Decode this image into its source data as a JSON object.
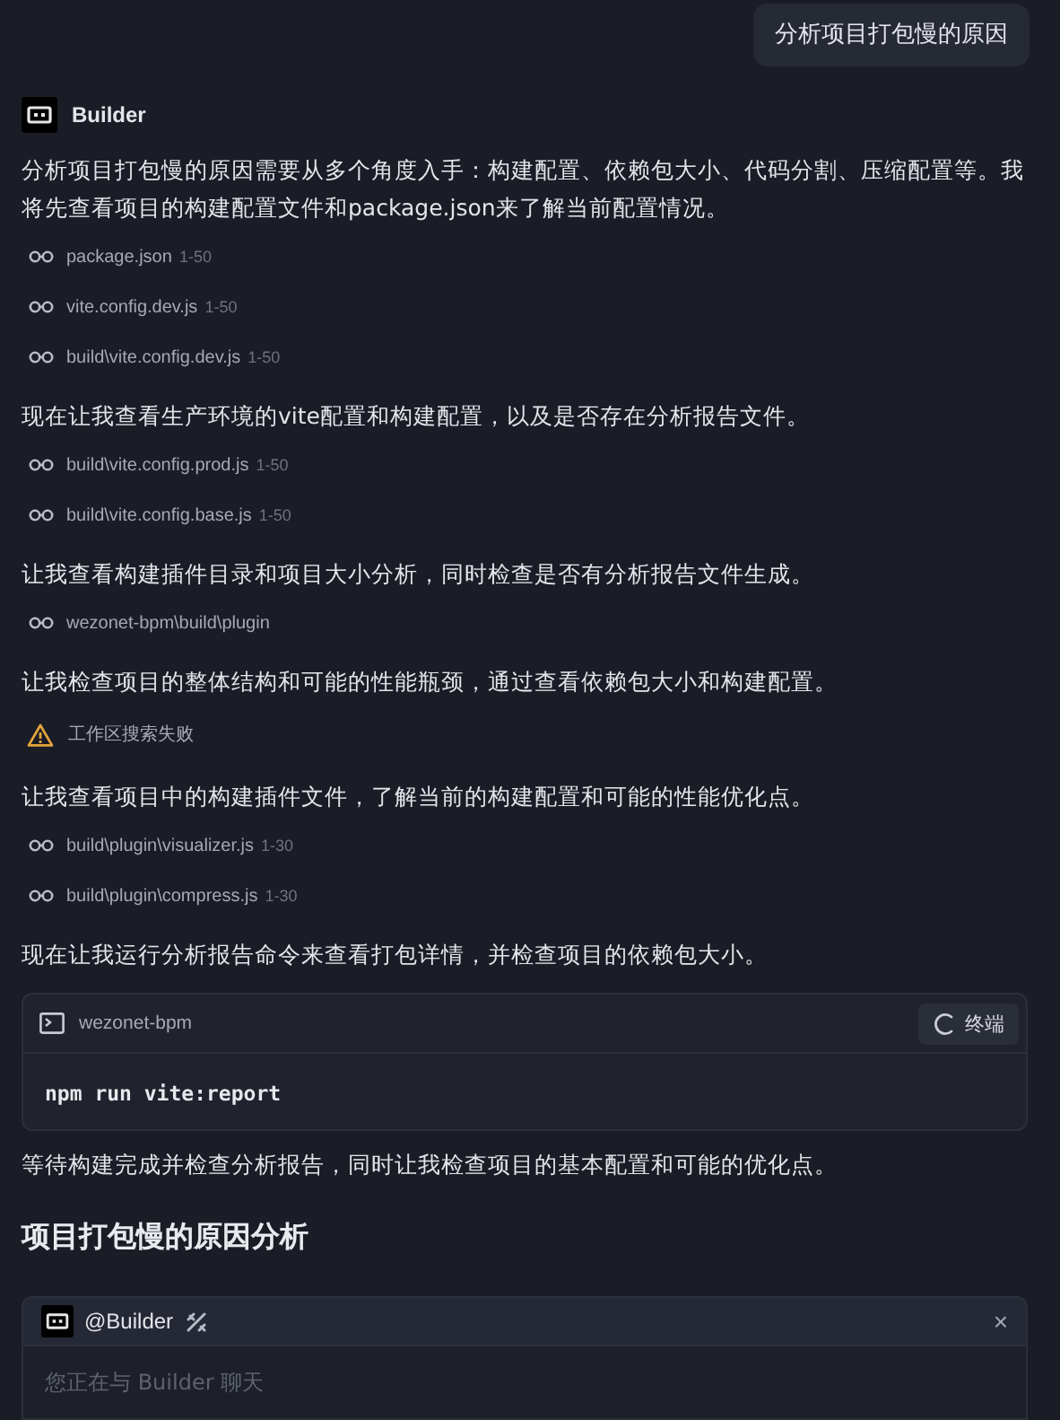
{
  "user_message": "分析项目打包慢的原因",
  "agent": {
    "name": "Builder"
  },
  "blocks": [
    {
      "kind": "paragraph",
      "text": "分析项目打包慢的原因需要从多个角度入手：构建配置、依赖包大小、代码分割、压缩配置等。我将先查看项目的构建配置文件和package.json来了解当前配置情况。"
    },
    {
      "kind": "file",
      "path": "package.json",
      "range": "1-50"
    },
    {
      "kind": "file",
      "path": "vite.config.dev.js",
      "range": "1-50"
    },
    {
      "kind": "file",
      "path": "build\\vite.config.dev.js",
      "range": "1-50"
    },
    {
      "kind": "paragraph",
      "text": "现在让我查看生产环境的vite配置和构建配置，以及是否存在分析报告文件。"
    },
    {
      "kind": "file",
      "path": "build\\vite.config.prod.js",
      "range": "1-50"
    },
    {
      "kind": "file",
      "path": "build\\vite.config.base.js",
      "range": "1-50"
    },
    {
      "kind": "paragraph",
      "text": "让我查看构建插件目录和项目大小分析，同时检查是否有分析报告文件生成。"
    },
    {
      "kind": "file",
      "path": "wezonet-bpm\\build\\plugin"
    },
    {
      "kind": "paragraph",
      "text": "让我检查项目的整体结构和可能的性能瓶颈，通过查看依赖包大小和构建配置。"
    },
    {
      "kind": "warning",
      "text": "工作区搜索失败"
    },
    {
      "kind": "paragraph",
      "text": "让我查看项目中的构建插件文件，了解当前的构建配置和可能的性能优化点。"
    },
    {
      "kind": "file",
      "path": "build\\plugin\\visualizer.js",
      "range": "1-30"
    },
    {
      "kind": "file",
      "path": "build\\plugin\\compress.js",
      "range": "1-30"
    },
    {
      "kind": "paragraph",
      "text": "现在让我运行分析报告命令来查看打包详情，并检查项目的依赖包大小。"
    },
    {
      "kind": "terminal",
      "cwd": "wezonet-bpm",
      "button": "终端",
      "running": true,
      "command": "npm run vite:report"
    },
    {
      "kind": "paragraph",
      "text": "等待构建完成并检查分析报告，同时让我检查项目的基本配置和可能的优化点。"
    },
    {
      "kind": "heading",
      "text": "项目打包慢的原因分析"
    }
  ],
  "composer": {
    "mention": "@Builder",
    "placeholder": "您正在与 Builder 聊天",
    "close": "×"
  }
}
